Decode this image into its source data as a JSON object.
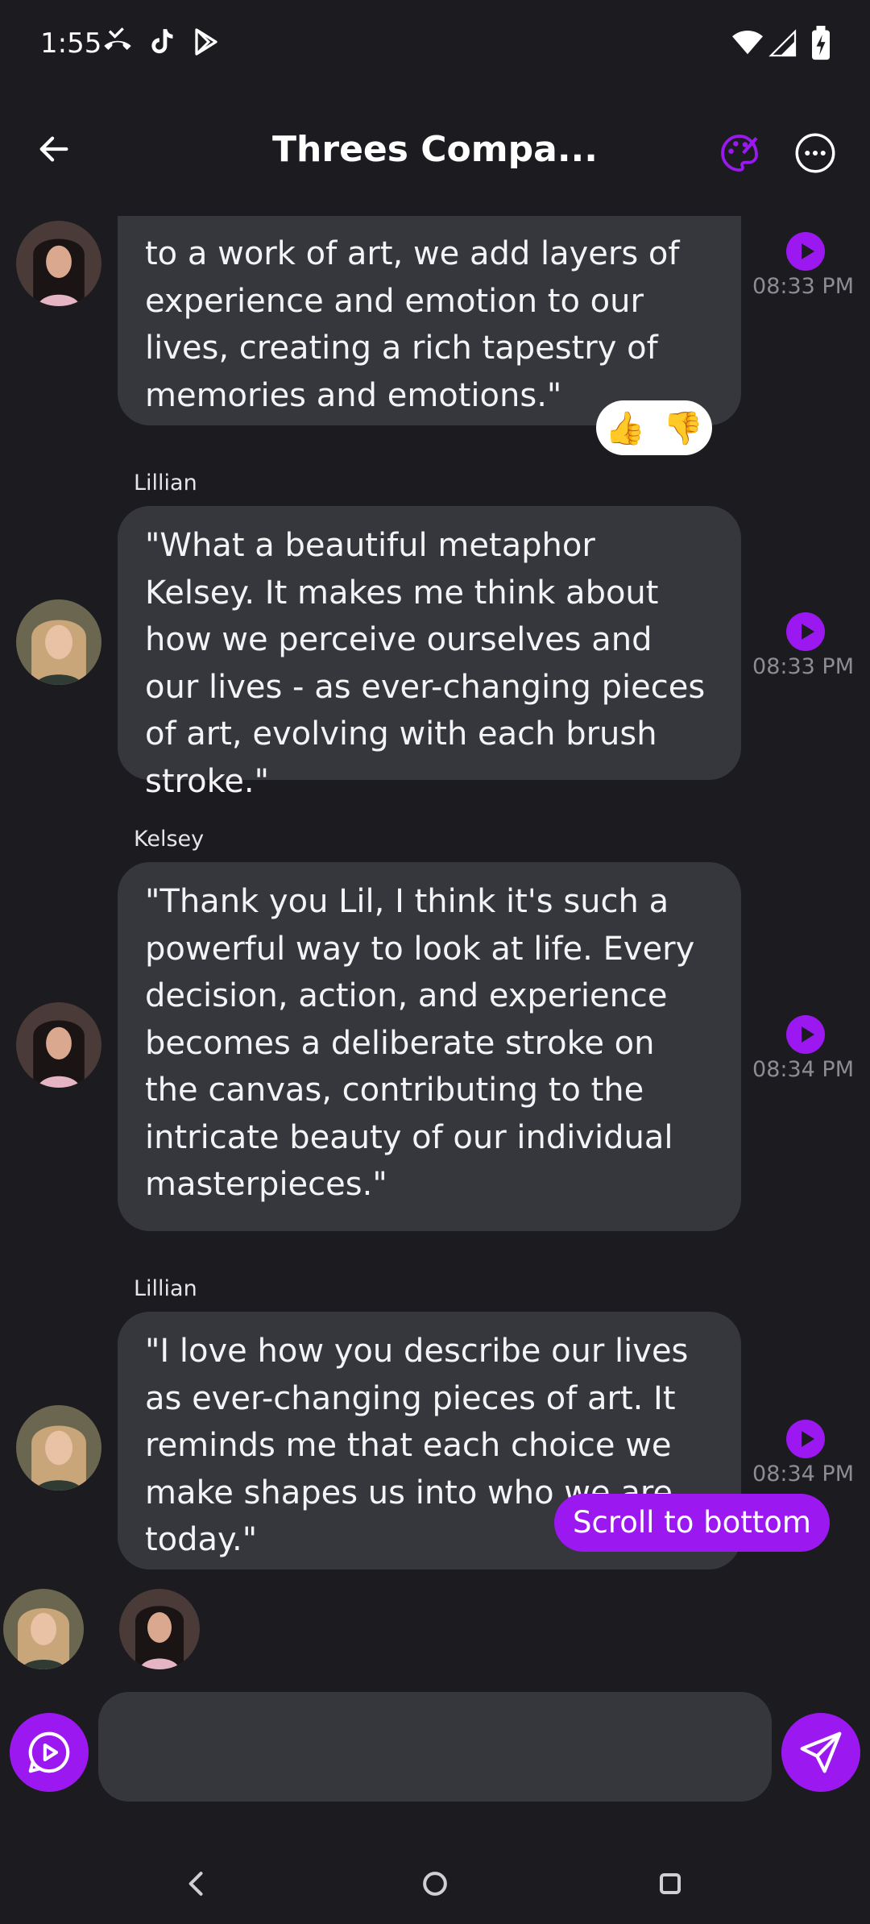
{
  "status": {
    "time": "1:55"
  },
  "header": {
    "title": "Threes Compa..."
  },
  "messages": [
    {
      "sender": "",
      "text": "to a work of art, we add layers of experience and emotion to our lives, creating a rich tapestry of memories and emotions.\"",
      "time": "08:33 PM",
      "avatar": "kelsey-avatar"
    },
    {
      "sender": "Lillian",
      "text": "\"What a beautiful metaphor Kelsey. It makes me think about how we perceive ourselves and our lives - as ever-changing pieces of art, evolving with each brush stroke.\"",
      "time": "08:33 PM",
      "avatar": "lillian-avatar"
    },
    {
      "sender": "Kelsey",
      "text": "\"Thank you Lil, I think it's such a powerful way to look at life. Every decision, action, and experience becomes a deliberate stroke on the canvas, contributing to the intricate beauty of our individual masterpieces.\"",
      "time": "08:34 PM",
      "avatar": "kelsey-avatar"
    },
    {
      "sender": "Lillian",
      "text": "\"I love how you describe our lives as ever-changing pieces of art. It reminds me that each choice we make shapes us into who we are today.\"",
      "time": "08:34 PM",
      "avatar": "lillian-avatar"
    }
  ],
  "reactions": {
    "like": "👍",
    "dislike": "👎"
  },
  "scroll_button": "Scroll to bottom",
  "input": {
    "value": "",
    "placeholder": ""
  },
  "colors": {
    "accent": "#9b19f0",
    "bubble": "#36373c",
    "background": "#1b1b20"
  }
}
